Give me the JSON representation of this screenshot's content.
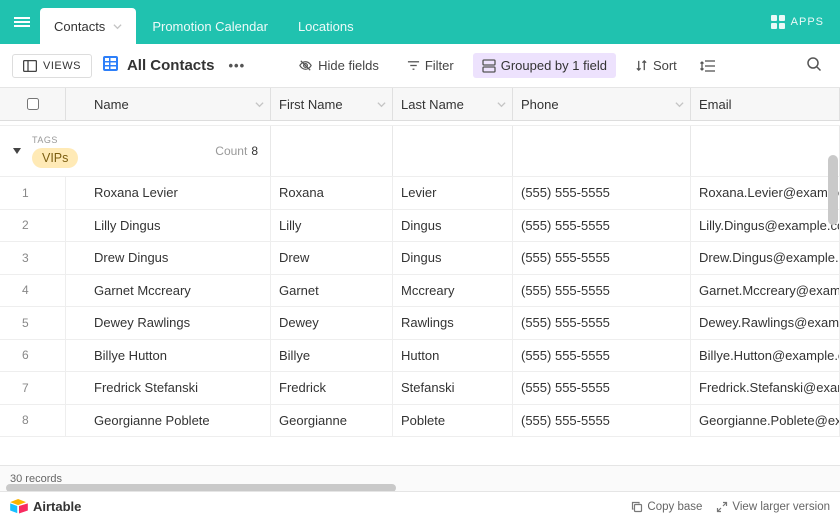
{
  "header": {
    "tabs": [
      {
        "label": "Contacts",
        "active": true
      },
      {
        "label": "Promotion Calendar",
        "active": false
      },
      {
        "label": "Locations",
        "active": false
      }
    ],
    "apps_label": "APPS"
  },
  "toolbar": {
    "views_label": "VIEWS",
    "view_name": "All Contacts",
    "hide_fields": "Hide fields",
    "filter": "Filter",
    "grouped": "Grouped by 1 field",
    "sort": "Sort"
  },
  "columns": {
    "name": "Name",
    "first": "First Name",
    "last": "Last Name",
    "phone": "Phone",
    "email": "Email"
  },
  "group": {
    "field_label": "TAGS",
    "value": "VIPs",
    "count_label": "Count",
    "count": "8"
  },
  "rows": [
    {
      "n": "1",
      "name": "Roxana Levier",
      "first": "Roxana",
      "last": "Levier",
      "phone": "(555) 555-5555",
      "email": "Roxana.Levier@example.com"
    },
    {
      "n": "2",
      "name": "Lilly Dingus",
      "first": "Lilly",
      "last": "Dingus",
      "phone": "(555) 555-5555",
      "email": "Lilly.Dingus@example.com"
    },
    {
      "n": "3",
      "name": "Drew Dingus",
      "first": "Drew",
      "last": "Dingus",
      "phone": "(555) 555-5555",
      "email": "Drew.Dingus@example.com"
    },
    {
      "n": "4",
      "name": "Garnet Mccreary",
      "first": "Garnet",
      "last": "Mccreary",
      "phone": "(555) 555-5555",
      "email": "Garnet.Mccreary@example.com"
    },
    {
      "n": "5",
      "name": "Dewey Rawlings",
      "first": "Dewey",
      "last": "Rawlings",
      "phone": "(555) 555-5555",
      "email": "Dewey.Rawlings@example.com"
    },
    {
      "n": "6",
      "name": "Billye Hutton",
      "first": "Billye",
      "last": "Hutton",
      "phone": "(555) 555-5555",
      "email": "Billye.Hutton@example.com"
    },
    {
      "n": "7",
      "name": "Fredrick Stefanski",
      "first": "Fredrick",
      "last": "Stefanski",
      "phone": "(555) 555-5555",
      "email": "Fredrick.Stefanski@example.com"
    },
    {
      "n": "8",
      "name": "Georgianne Poblete",
      "first": "Georgianne",
      "last": "Poblete",
      "phone": "(555) 555-5555",
      "email": "Georgianne.Poblete@example.com"
    }
  ],
  "footer": {
    "records": "30 records",
    "brand": "Airtable",
    "copy": "Copy base",
    "larger": "View larger version"
  }
}
